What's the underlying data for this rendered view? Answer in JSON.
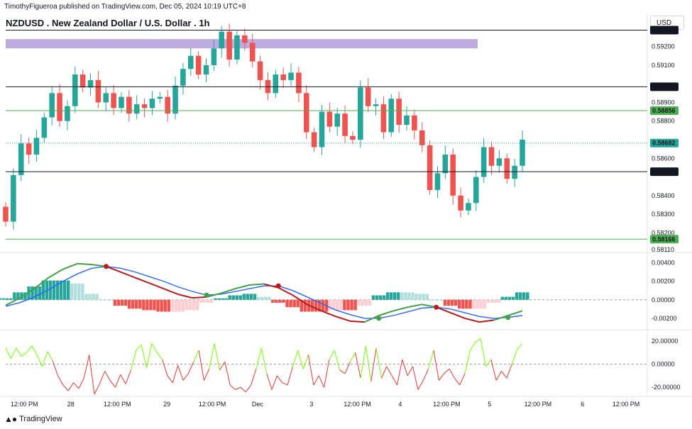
{
  "header": {
    "meta": "TimothyFigueroa published on TradingView.com, Dec 05, 2024 10:19 UTC+8",
    "title": "NZDUSD . New Zealand Dollar / U.S. Dollar . 1h",
    "currency_button": "USD"
  },
  "footer": {
    "brand": "TradingView"
  },
  "colors": {
    "up": "#26a69a",
    "down": "#ef5350",
    "zone": "#b39ddb",
    "price_label_bg": "#131722",
    "green_label_bg": "#4caf50",
    "macd_line": "#43a047",
    "macd_signal": "#2962ff",
    "macd_dark": "#b71c1c"
  },
  "chart_data": [
    {
      "type": "candlestick",
      "panel": "price",
      "y_ticks": [
        "0.59200",
        "0.59100",
        "0.58900",
        "0.58800",
        "0.58600",
        "0.58400",
        "0.58300",
        "0.58200",
        "0.58110"
      ],
      "ylim": [
        0.5811,
        0.5929
      ],
      "horizontal_lines": [
        {
          "value": 0.59288,
          "label": "0.59288",
          "style": "black"
        },
        {
          "value": 0.58984,
          "label": "0.58984",
          "style": "black"
        },
        {
          "value": 0.58856,
          "label": "0.58856",
          "style": "green"
        },
        {
          "value": 0.58682,
          "label": "0.58682",
          "style": "current"
        },
        {
          "value": 0.58528,
          "label": "0.58528",
          "style": "black"
        },
        {
          "value": 0.58166,
          "label": "0.58166",
          "style": "green"
        }
      ],
      "zone": {
        "top": 0.5924,
        "bottom": 0.5919
      },
      "close_path": [
        0.5826,
        0.5851,
        0.5868,
        0.5862,
        0.5871,
        0.5882,
        0.5895,
        0.588,
        0.5888,
        0.5905,
        0.5898,
        0.5902,
        0.589,
        0.5895,
        0.5887,
        0.5893,
        0.5884,
        0.5889,
        0.5887,
        0.5892,
        0.5893,
        0.5884,
        0.5899,
        0.5908,
        0.5915,
        0.5905,
        0.591,
        0.5919,
        0.5928,
        0.5913,
        0.5926,
        0.5922,
        0.5912,
        0.5902,
        0.5895,
        0.5905,
        0.5902,
        0.5906,
        0.5895,
        0.5874,
        0.5866,
        0.5885,
        0.5877,
        0.5884,
        0.5872,
        0.587,
        0.5898,
        0.5888,
        0.5889,
        0.5874,
        0.5892,
        0.5878,
        0.5883,
        0.5875,
        0.5867,
        0.5843,
        0.5852,
        0.5862,
        0.584,
        0.5832,
        0.5836,
        0.585,
        0.5866,
        0.5856,
        0.586,
        0.5849,
        0.5856,
        0.587
      ]
    },
    {
      "type": "macd",
      "panel": "indicator-1",
      "y_ticks": [
        "0.00400",
        "0.00200",
        "0.00000",
        "-0.00200"
      ],
      "ylim": [
        -0.003,
        0.0048
      ],
      "macd": [
        -0.0006,
        0.0002,
        0.0012,
        0.0024,
        0.0033,
        0.0039,
        0.0038,
        0.0036,
        0.003,
        0.0024,
        0.0018,
        0.0012,
        0.0006,
        0.0002,
        0.0003,
        0.0007,
        0.0012,
        0.0016,
        0.0017,
        0.0013,
        0.0005,
        -0.0005,
        -0.0012,
        -0.0018,
        -0.0023,
        -0.0024,
        -0.0017,
        -0.0012,
        -0.0008,
        -0.0005,
        -0.0008,
        -0.0014,
        -0.002,
        -0.0024,
        -0.0022,
        -0.0017,
        -0.0012
      ],
      "signal": [
        -0.0007,
        -0.0003,
        0.0003,
        0.0011,
        0.002,
        0.0028,
        0.0034,
        0.0036,
        0.0034,
        0.003,
        0.0025,
        0.002,
        0.0014,
        0.0009,
        0.0005,
        0.0006,
        0.0009,
        0.0012,
        0.0015,
        0.0015,
        0.001,
        0.0003,
        -0.0004,
        -0.0011,
        -0.0016,
        -0.002,
        -0.002,
        -0.0017,
        -0.0013,
        -0.0009,
        -0.0008,
        -0.001,
        -0.0014,
        -0.0018,
        -0.002,
        -0.0019,
        -0.0017
      ],
      "crossovers": [
        {
          "index": 7,
          "kind": "bearish"
        },
        {
          "index": 14,
          "kind": "bullish"
        },
        {
          "index": 19,
          "kind": "bearish"
        },
        {
          "index": 26,
          "kind": "bullish"
        },
        {
          "index": 30,
          "kind": "bearish"
        },
        {
          "index": 35,
          "kind": "bullish"
        }
      ]
    },
    {
      "type": "line",
      "panel": "indicator-2",
      "y_ticks": [
        "20.00000",
        "0.00000",
        "-20.00000"
      ],
      "ylim": [
        -26,
        28
      ],
      "values": [
        14,
        5,
        14,
        7,
        10,
        16,
        8,
        -2,
        11,
        3,
        -10,
        -18,
        -23,
        -16,
        -21,
        -12,
        8,
        -26,
        -17,
        -6,
        -14,
        -20,
        -9,
        -17,
        -5,
        12,
        17,
        -3,
        18,
        10,
        4,
        -10,
        -16,
        -1,
        -14,
        -8,
        2,
        12,
        -14,
        -4,
        18,
        -5,
        2,
        -18,
        -22,
        -20,
        -24,
        -18,
        -4,
        14,
        -8,
        -22,
        -10,
        -16,
        -18,
        -2,
        12,
        -4,
        8,
        -18,
        -10,
        -20,
        4,
        12,
        -5,
        -8,
        2,
        10,
        -12,
        16,
        -15,
        14,
        -12,
        -2,
        -10,
        -18,
        4,
        -10,
        -2,
        -22,
        -14,
        -4,
        12,
        -14,
        -8,
        -4,
        -12,
        -18,
        -8,
        12,
        19,
        22,
        -2,
        4,
        -14,
        -6,
        -12,
        0,
        13,
        18
      ],
      "zero_line": 0
    }
  ],
  "x_axis": {
    "ticks": [
      {
        "label": "12:00 PM",
        "pos": 0.03
      },
      {
        "label": "28",
        "pos": 0.105
      },
      {
        "label": "12:00 PM",
        "pos": 0.18
      },
      {
        "label": "29",
        "pos": 0.26
      },
      {
        "label": "12:00 PM",
        "pos": 0.333
      },
      {
        "label": "Dec",
        "pos": 0.406
      },
      {
        "label": "3",
        "pos": 0.493
      },
      {
        "label": "12:00 PM",
        "pos": 0.567
      },
      {
        "label": "4",
        "pos": 0.636
      },
      {
        "label": "12:00 PM",
        "pos": 0.711
      },
      {
        "label": "5",
        "pos": 0.78
      },
      {
        "label": "12:00 PM",
        "pos": 0.858
      },
      {
        "label": "6",
        "pos": 0.93
      },
      {
        "label": "12:00 PM",
        "pos": 1.0
      }
    ]
  }
}
